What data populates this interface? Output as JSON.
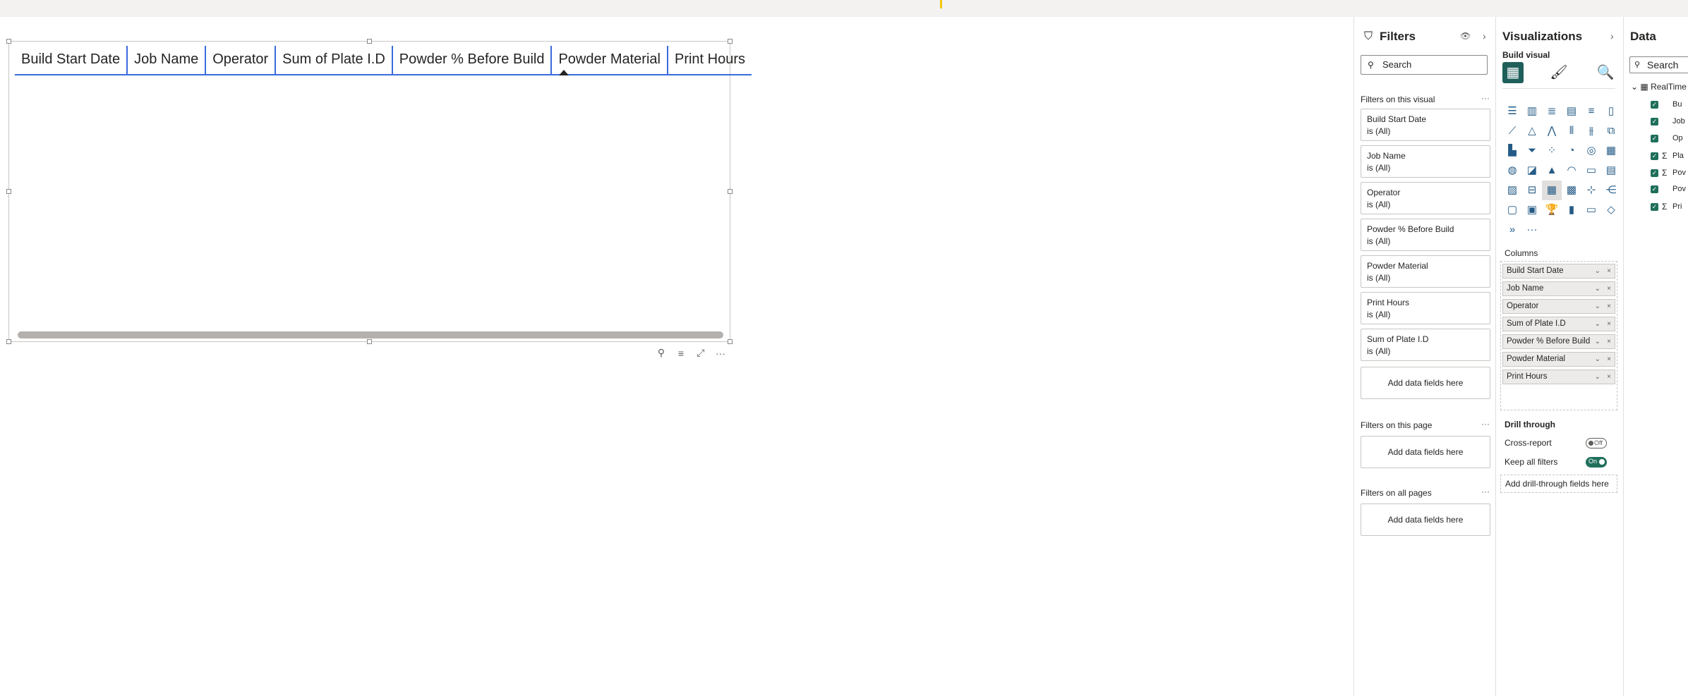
{
  "table": {
    "columns": [
      "Build Start Date",
      "Job Name",
      "Operator",
      "Sum of Plate I.D",
      "Powder % Before Build",
      "Powder Material",
      "Print Hours"
    ],
    "sorted_column_index": 5
  },
  "visual_actions": {
    "pin": "⚲",
    "filter": "≡",
    "focus": "⤢",
    "more": "···"
  },
  "filters": {
    "title": "Filters",
    "search_placeholder": "Search",
    "on_visual_label": "Filters on this visual",
    "visual_filters": [
      {
        "field": "Build Start Date",
        "state": "is (All)"
      },
      {
        "field": "Job Name",
        "state": "is (All)"
      },
      {
        "field": "Operator",
        "state": "is (All)"
      },
      {
        "field": "Powder % Before Build",
        "state": "is (All)"
      },
      {
        "field": "Powder Material",
        "state": "is (All)"
      },
      {
        "field": "Print Hours",
        "state": "is (All)"
      },
      {
        "field": "Sum of Plate I.D",
        "state": "is (All)"
      }
    ],
    "add_fields": "Add data fields here",
    "on_page_label": "Filters on this page",
    "all_pages_label": "Filters on all pages",
    "more": "···"
  },
  "visualizations": {
    "title": "Visualizations",
    "build_visual": "Build visual",
    "columns_label": "Columns",
    "column_wells": [
      "Build Start Date",
      "Job Name",
      "Operator",
      "Sum of Plate I.D",
      "Powder % Before Build",
      "Powder Material",
      "Print Hours"
    ],
    "drill_through": "Drill through",
    "cross_report": "Cross-report",
    "cross_report_state": "Off",
    "keep_all_filters": "Keep all filters",
    "keep_all_filters_state": "On",
    "drill_add": "Add drill-through fields here",
    "more_visuals": "···"
  },
  "data": {
    "title": "Data",
    "search_placeholder": "Search",
    "table_name": "RealTime",
    "fields": [
      {
        "name": "Bu",
        "sigma": false
      },
      {
        "name": "Job",
        "sigma": false
      },
      {
        "name": "Op",
        "sigma": false
      },
      {
        "name": "Pla",
        "sigma": true
      },
      {
        "name": "Pov",
        "sigma": true
      },
      {
        "name": "Pov",
        "sigma": false
      },
      {
        "name": "Pri",
        "sigma": true
      }
    ]
  },
  "colors": {
    "accent": "#3a6bdc",
    "toggle_on": "#1f6f5b",
    "visual_active": "#1f5f5b"
  }
}
